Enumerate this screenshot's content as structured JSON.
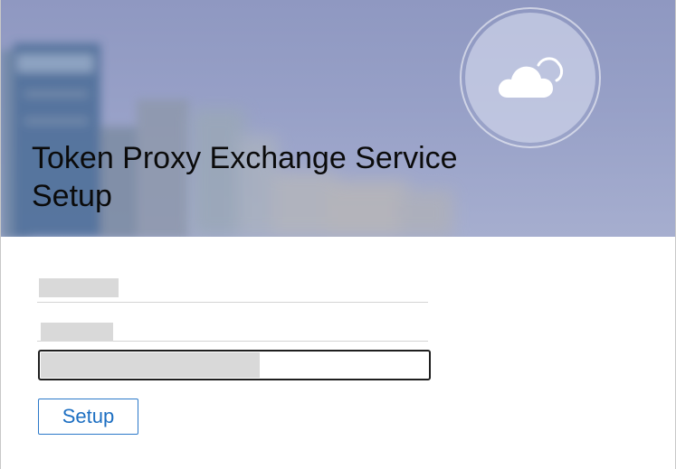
{
  "header": {
    "title": "Token Proxy Exchange Service Setup",
    "logo_icon": "cloud-icon"
  },
  "form": {
    "field_1_label": "",
    "field_2_label": "",
    "input_value": "",
    "input_fill_fraction": 0.56
  },
  "actions": {
    "setup_label": "Setup"
  },
  "colors": {
    "header_background": "#97a0c7",
    "button_text": "#1d6fc2",
    "button_border": "#2b79c9",
    "redacted_gray": "#d9d9d9"
  }
}
